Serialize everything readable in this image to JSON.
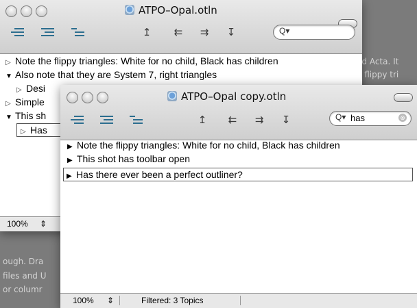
{
  "background_text": {
    "right_line_1": "ed Acta. It",
    "right_line_2": "e flippy tri",
    "left_line_1": "ough. Dra",
    "left_line_2": "files and U",
    "left_line_3": "or columr"
  },
  "back_window": {
    "title": "ATPO–Opal.otln",
    "search_icon": "Q▾",
    "rows": [
      {
        "triangle": "▷",
        "text": "Note the flippy triangles: White for no child, Black has children"
      },
      {
        "triangle": "▼",
        "text": "Also note that they are System 7, right triangles"
      },
      {
        "triangle": "▷",
        "text": "Desi"
      },
      {
        "triangle": "▷",
        "text": "Simple"
      },
      {
        "triangle": "▼",
        "text": "This sh"
      },
      {
        "triangle": "▷",
        "text": "Has"
      }
    ],
    "zoom": "100%",
    "stepper": "⇕"
  },
  "front_window": {
    "title": "ATPO–Opal copy.otln",
    "search_icon": "Q▾",
    "search_value": "has",
    "clear_icon": "⊗",
    "rows": [
      {
        "triangle": "▶",
        "text": "Note the flippy triangles: White for no child, Black has children"
      },
      {
        "triangle": "▶",
        "text": "This shot has toolbar open"
      },
      {
        "triangle": "▶",
        "text": "Has there ever been a perfect outliner?"
      }
    ],
    "zoom": "100%",
    "stepper": "⇕",
    "status": "Filtered: 3 Topics"
  },
  "toolbar_icons": {
    "move_up": "↥",
    "move_left": "⇇",
    "move_right": "⇉",
    "move_down": "↧"
  }
}
